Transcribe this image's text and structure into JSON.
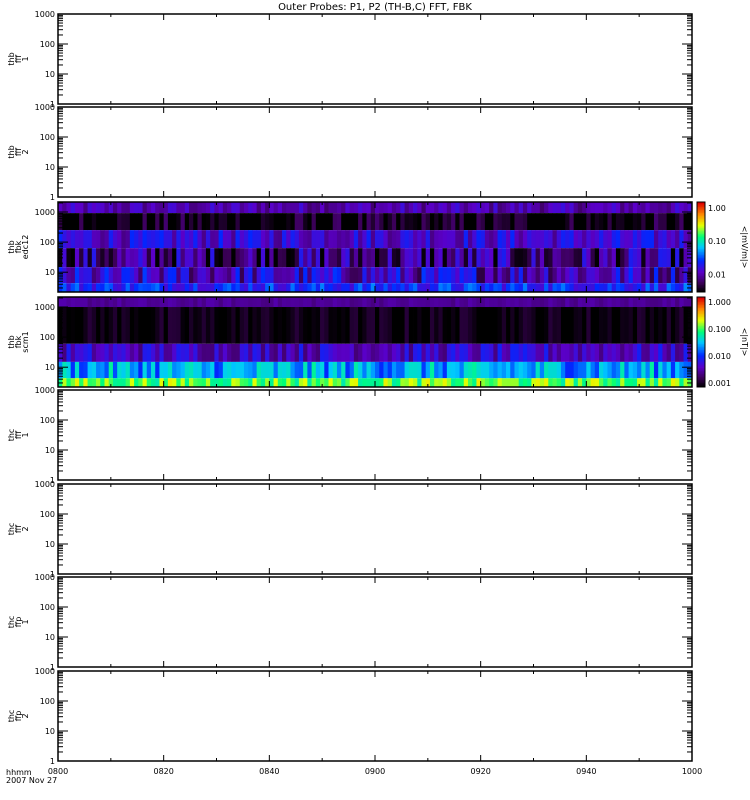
{
  "chart_data": {
    "type": "heatmap",
    "title": "Outer Probes: P1, P2 (TH-B,C) FFT, FBK",
    "x_axis": {
      "label_line1": "hhmm",
      "label_line2": "2007 Nov 27",
      "range_minutes": [
        0,
        120
      ],
      "tick_labels": [
        "0800",
        "0820",
        "0840",
        "0900",
        "0920",
        "0940",
        "1000"
      ]
    },
    "panels": [
      {
        "id": "thb-fff-1",
        "ylabel": [
          "thb",
          "fff",
          "1"
        ],
        "yscale": "log",
        "ylim": [
          1,
          1000
        ],
        "y_tick_labels": [
          "1",
          "10",
          "100",
          "1000"
        ],
        "has_data": false
      },
      {
        "id": "thb-fff-2",
        "ylabel": [
          "thb",
          "fff",
          "2"
        ],
        "yscale": "log",
        "ylim": [
          1,
          1000
        ],
        "y_tick_labels": [
          "1",
          "10",
          "100",
          "1000"
        ],
        "has_data": false
      },
      {
        "id": "thb-fbk-edc12",
        "ylabel": [
          "thb",
          "fbk",
          "edc12"
        ],
        "yscale": "log",
        "ylim": [
          2.2,
          2150
        ],
        "y_tick_labels": [
          "10",
          "100",
          "1000"
        ],
        "has_data": true,
        "colorbar": {
          "label": "<|mV/m|>",
          "range": [
            0.003,
            1.5
          ],
          "tick_labels": [
            "0.01",
            "0.10",
            "1.00"
          ],
          "ticks": [
            0.01,
            0.1,
            1.0
          ]
        },
        "bands": [
          {
            "f_lo": 920,
            "f_hi": 2150,
            "median": 0.01,
            "spread": 0.15
          },
          {
            "f_lo": 250,
            "f_hi": 920,
            "median": 0.003,
            "spread": 0.25
          },
          {
            "f_lo": 63,
            "f_hi": 250,
            "median": 0.014,
            "spread": 0.2
          },
          {
            "f_lo": 14.7,
            "f_hi": 63,
            "median": 0.007,
            "spread": 0.35
          },
          {
            "f_lo": 4.3,
            "f_hi": 14.7,
            "median": 0.012,
            "spread": 0.3
          },
          {
            "f_lo": 2.2,
            "f_hi": 4.3,
            "median": 0.025,
            "spread": 0.2
          }
        ]
      },
      {
        "id": "thb-fbk-scm1",
        "ylabel": [
          "thb",
          "fbk",
          "scm1"
        ],
        "yscale": "log",
        "ylim": [
          2.2,
          2150
        ],
        "y_tick_labels": [
          "10",
          "100",
          "1000"
        ],
        "has_data": true,
        "colorbar": {
          "label": "<|nT|>",
          "range": [
            0.0007,
            1.5
          ],
          "tick_labels": [
            "0.001",
            "0.010",
            "0.100",
            "1.000"
          ],
          "ticks": [
            0.001,
            0.01,
            0.1,
            1.0
          ]
        },
        "bands": [
          {
            "f_lo": 1000,
            "f_hi": 2150,
            "median": 0.0025,
            "spread": 0.05
          },
          {
            "f_lo": 60,
            "f_hi": 1000,
            "median": 0.0008,
            "spread": 0.1
          },
          {
            "f_lo": 15,
            "f_hi": 60,
            "median": 0.004,
            "spread": 0.2
          },
          {
            "f_lo": 4.3,
            "f_hi": 15,
            "median": 0.025,
            "spread": 0.25
          },
          {
            "f_lo": 2.2,
            "f_hi": 4.3,
            "median": 0.12,
            "spread": 0.2
          }
        ]
      },
      {
        "id": "thc-fff-1",
        "ylabel": [
          "thc",
          "fff",
          "1"
        ],
        "yscale": "log",
        "ylim": [
          1,
          1000
        ],
        "y_tick_labels": [
          "1",
          "10",
          "100",
          "1000"
        ],
        "has_data": false
      },
      {
        "id": "thc-fff-2",
        "ylabel": [
          "thc",
          "fff",
          "2"
        ],
        "yscale": "log",
        "ylim": [
          1,
          1000
        ],
        "y_tick_labels": [
          "1",
          "10",
          "100",
          "1000"
        ],
        "has_data": false
      },
      {
        "id": "thc-ffp-1",
        "ylabel": [
          "thc",
          "ffp",
          "1"
        ],
        "yscale": "log",
        "ylim": [
          1,
          1000
        ],
        "y_tick_labels": [
          "1",
          "10",
          "100",
          "1000"
        ],
        "has_data": false
      },
      {
        "id": "thc-ffp-2",
        "ylabel": [
          "thc",
          "ffp",
          "2"
        ],
        "yscale": "log",
        "ylim": [
          1,
          1000
        ],
        "y_tick_labels": [
          "1",
          "10",
          "100",
          "1000"
        ],
        "has_data": false
      }
    ]
  }
}
